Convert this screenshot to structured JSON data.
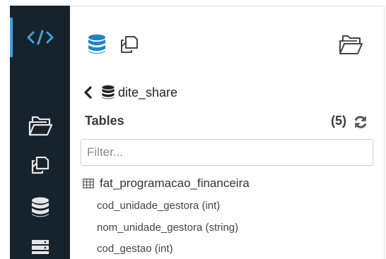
{
  "sidebar": {
    "items": [
      {
        "icon": "code-icon"
      },
      {
        "icon": "folder-open-icon"
      },
      {
        "icon": "copy-icon"
      },
      {
        "icon": "database-icon"
      },
      {
        "icon": "server-icon"
      }
    ]
  },
  "toolbar": {
    "icons": [
      "database-icon",
      "copy-icon",
      "folder-open-icon"
    ]
  },
  "assist": {
    "database_name": "dite_share",
    "tables_label": "Tables",
    "tables_count": "(5)",
    "filter_placeholder": "Filter...",
    "table_name": "fat_programacao_financeira",
    "columns": [
      "cod_unidade_gestora (int)",
      "nom_unidade_gestora (string)",
      "cod_gestao (int)"
    ]
  },
  "colors": {
    "sidebar_bg": "#17232c",
    "accent": "#4a9fd8"
  }
}
